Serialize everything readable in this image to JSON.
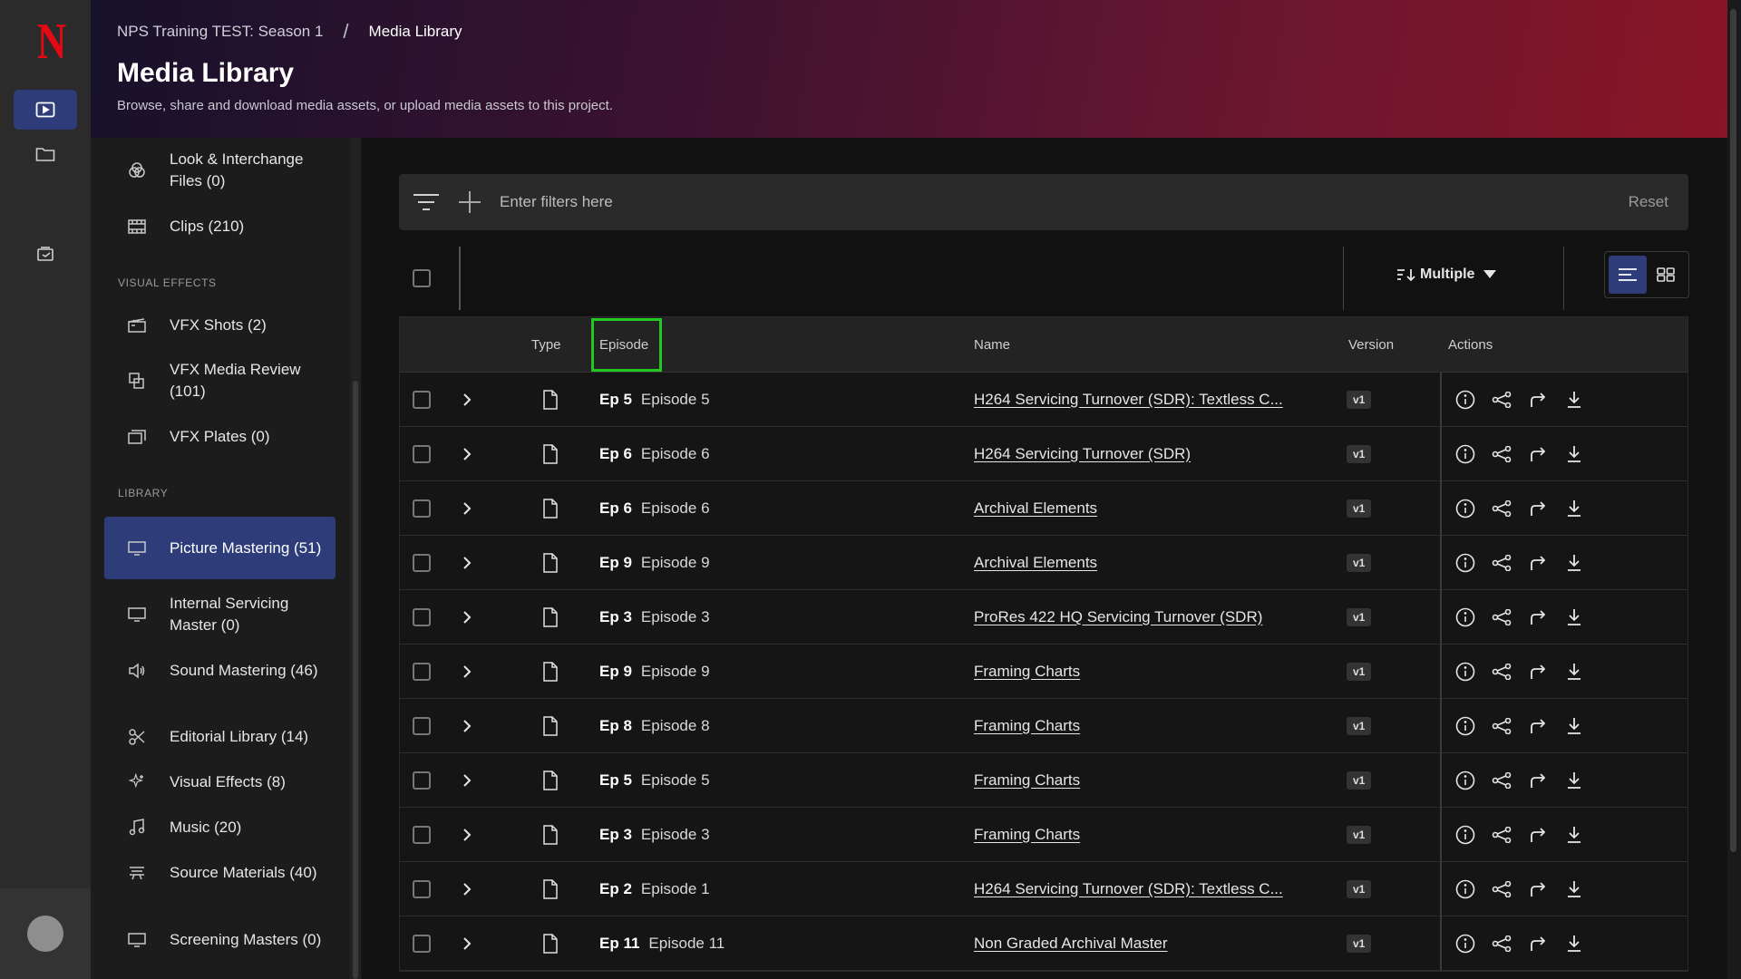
{
  "breadcrumb": {
    "parent": "NPS Training TEST: Season 1",
    "separator": "/",
    "current": "Media Library"
  },
  "header": {
    "title": "Media Library",
    "subtitle": "Browse, share and download media assets, or upload media assets to this project."
  },
  "sidebar": {
    "items_top": [
      {
        "label": "Look & Interchange Files (0)",
        "icon": "color-circles-icon"
      },
      {
        "label": "Clips (210)",
        "icon": "film-icon"
      }
    ],
    "section_vfx": "VISUAL EFFECTS",
    "items_vfx": [
      {
        "label": "VFX Shots (2)",
        "icon": "clapper-icon"
      },
      {
        "label": "VFX Media Review (101)",
        "icon": "review-icon"
      },
      {
        "label": "VFX Plates (0)",
        "icon": "plates-icon"
      }
    ],
    "section_library": "LIBRARY",
    "items_library": [
      {
        "label": "Picture Mastering (51)",
        "icon": "monitor-icon",
        "active": true
      },
      {
        "label": "Internal Servicing Master (0)",
        "icon": "monitor-icon"
      },
      {
        "label": "Sound Mastering (46)",
        "icon": "speaker-icon"
      },
      {
        "label": "Editorial Library (14)",
        "icon": "scissors-icon"
      },
      {
        "label": "Visual Effects (8)",
        "icon": "sparkle-icon"
      },
      {
        "label": "Music (20)",
        "icon": "music-icon"
      },
      {
        "label": "Source Materials (40)",
        "icon": "stack-icon"
      },
      {
        "label": "Screening Masters (0)",
        "icon": "monitor-icon"
      }
    ]
  },
  "filter": {
    "placeholder": "Enter filters here",
    "reset_label": "Reset"
  },
  "toolbar": {
    "sort_label": "Multiple"
  },
  "table": {
    "columns": {
      "type": "Type",
      "episode": "Episode",
      "name": "Name",
      "version": "Version",
      "actions": "Actions"
    },
    "rows": [
      {
        "ep_code": "Ep 5",
        "ep_name": "Episode 5",
        "name": "H264 Servicing Turnover (SDR): Textless C...",
        "version": "v1"
      },
      {
        "ep_code": "Ep 6",
        "ep_name": "Episode 6",
        "name": "H264 Servicing Turnover (SDR)",
        "version": "v1"
      },
      {
        "ep_code": "Ep 6",
        "ep_name": "Episode 6",
        "name": "Archival Elements",
        "version": "v1"
      },
      {
        "ep_code": "Ep 9",
        "ep_name": "Episode 9",
        "name": "Archival Elements",
        "version": "v1"
      },
      {
        "ep_code": "Ep 3",
        "ep_name": "Episode 3",
        "name": "ProRes 422 HQ Servicing Turnover (SDR)",
        "version": "v1"
      },
      {
        "ep_code": "Ep 9",
        "ep_name": "Episode 9",
        "name": "Framing Charts",
        "version": "v1"
      },
      {
        "ep_code": "Ep 8",
        "ep_name": "Episode 8",
        "name": "Framing Charts",
        "version": "v1"
      },
      {
        "ep_code": "Ep 5",
        "ep_name": "Episode 5",
        "name": "Framing Charts",
        "version": "v1"
      },
      {
        "ep_code": "Ep 3",
        "ep_name": "Episode 3",
        "name": "Framing Charts",
        "version": "v1"
      },
      {
        "ep_code": "Ep 2",
        "ep_name": "Episode 1",
        "name": "H264 Servicing Turnover (SDR): Textless C...",
        "version": "v1"
      },
      {
        "ep_code": "Ep 11",
        "ep_name": "Episode 11",
        "name": "Non Graded Archival Master",
        "version": "v1"
      }
    ]
  },
  "colors": {
    "accent": "#2e3d79",
    "brand": "#e50914",
    "highlight_box": "#22c722"
  }
}
